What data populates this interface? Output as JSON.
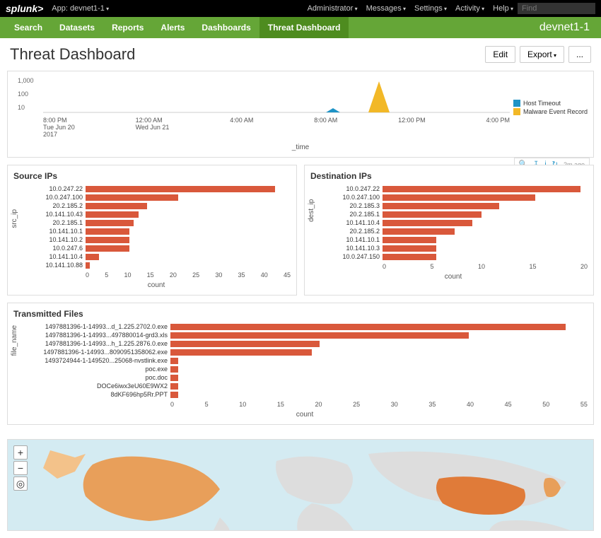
{
  "topbar": {
    "logo": "splunk>",
    "app_label": "App: devnet1-1",
    "menus": [
      "Administrator",
      "Messages",
      "Settings",
      "Activity",
      "Help"
    ],
    "find_placeholder": "Find"
  },
  "navbar": {
    "items": [
      "Search",
      "Datasets",
      "Reports",
      "Alerts",
      "Dashboards",
      "Threat Dashboard"
    ],
    "active_index": 5,
    "right_label": "devnet1-1"
  },
  "header": {
    "title": "Threat Dashboard",
    "edit_label": "Edit",
    "export_label": "Export",
    "more_label": "..."
  },
  "panel_toolbar": {
    "timestamp": "2m ago"
  },
  "timeline": {
    "y_ticks": [
      "1,000",
      "100",
      "10"
    ],
    "x_ticks": [
      {
        "t": "8:00 PM",
        "d": "Tue Jun 20",
        "y": "2017"
      },
      {
        "t": "12:00 AM",
        "d": "Wed Jun 21",
        "y": ""
      },
      {
        "t": "4:00 AM",
        "d": "",
        "y": ""
      },
      {
        "t": "8:00 AM",
        "d": "",
        "y": ""
      },
      {
        "t": "12:00 PM",
        "d": "",
        "y": ""
      },
      {
        "t": "4:00 PM",
        "d": "",
        "y": ""
      }
    ],
    "xlabel": "_time",
    "legend": [
      {
        "color": "#1e93c6",
        "label": "Host Timeout"
      },
      {
        "color": "#f2b827",
        "label": "Malware Event Record"
      }
    ]
  },
  "source_ips": {
    "title": "Source IPs",
    "yaxis": "src_ip",
    "xaxis": "count"
  },
  "dest_ips": {
    "title": "Destination IPs",
    "yaxis": "dest_ip",
    "xaxis": "count"
  },
  "files": {
    "title": "Transmitted Files",
    "yaxis": "file_name",
    "xaxis": "count"
  },
  "chart_data": [
    {
      "type": "line",
      "name": "timeline",
      "xlabel": "_time",
      "ylabel": "",
      "yscale": "log",
      "ylim": [
        1,
        1000
      ],
      "series": [
        {
          "name": "Host Timeout",
          "color": "#1e93c6",
          "points": [
            {
              "x": "~10:00 AM Wed Jun 21",
              "y": 3
            }
          ]
        },
        {
          "name": "Malware Event Record",
          "color": "#f2b827",
          "points": [
            {
              "x": "~12:00 PM Wed Jun 21",
              "y": 400
            }
          ]
        }
      ]
    },
    {
      "type": "bar",
      "name": "source_ips",
      "orientation": "horizontal",
      "xlabel": "count",
      "ylabel": "src_ip",
      "xlim": [
        0,
        45
      ],
      "x_ticks": [
        0,
        5,
        10,
        15,
        20,
        25,
        30,
        35,
        40,
        45
      ],
      "categories": [
        "10.0.247.22",
        "10.0.247.100",
        "20.2.185.2",
        "10.141.10.43",
        "20.2.185.1",
        "10.141.10.1",
        "10.141.10.2",
        "10.0.247.6",
        "10.141.10.4",
        "10.141.10.88"
      ],
      "values": [
        43,
        21,
        14,
        12,
        11,
        10,
        10,
        10,
        3,
        1
      ]
    },
    {
      "type": "bar",
      "name": "dest_ips",
      "orientation": "horizontal",
      "xlabel": "count",
      "ylabel": "dest_ip",
      "xlim": [
        0,
        22
      ],
      "x_ticks": [
        0,
        5,
        10,
        15,
        20
      ],
      "categories": [
        "10.0.247.22",
        "10.0.247.100",
        "20.2.185.3",
        "20.2.185.1",
        "10.141.10.4",
        "20.2.185.2",
        "10.141.10.1",
        "10.141.10.3",
        "10.0.247.150"
      ],
      "values": [
        22,
        17,
        13,
        11,
        10,
        8,
        6,
        6,
        6
      ]
    },
    {
      "type": "bar",
      "name": "transmitted_files",
      "orientation": "horizontal",
      "xlabel": "count",
      "ylabel": "file_name",
      "xlim": [
        0,
        55
      ],
      "x_ticks": [
        0,
        5,
        10,
        15,
        20,
        25,
        30,
        35,
        40,
        45,
        50,
        55
      ],
      "categories": [
        "1497881396-1-14993...d_1.225.2702.0.exe",
        "1497881396-1-14993...497880014-grd3.xls",
        "1497881396-1-14993...h_1.225.2876.0.exe",
        "1497881396-1-14993...8090951358062.exe",
        "1493724944-1-149520...25068-nvstlink.exe",
        "poc.exe",
        "poc.doc",
        "DOCe6iwx3eU60E9WX2",
        "8dKF696hp5Rr.PPT"
      ],
      "values": [
        53,
        40,
        20,
        19,
        1,
        1,
        1,
        1,
        1
      ]
    },
    {
      "type": "map",
      "name": "geo_map",
      "highlighted_regions": [
        {
          "region": "United States",
          "color": "#e89f5a"
        },
        {
          "region": "China",
          "color": "#e07b39"
        },
        {
          "region": "Japan",
          "color": "#e89f5a"
        },
        {
          "region": "Alaska",
          "color": "#f3c28a"
        }
      ]
    }
  ]
}
